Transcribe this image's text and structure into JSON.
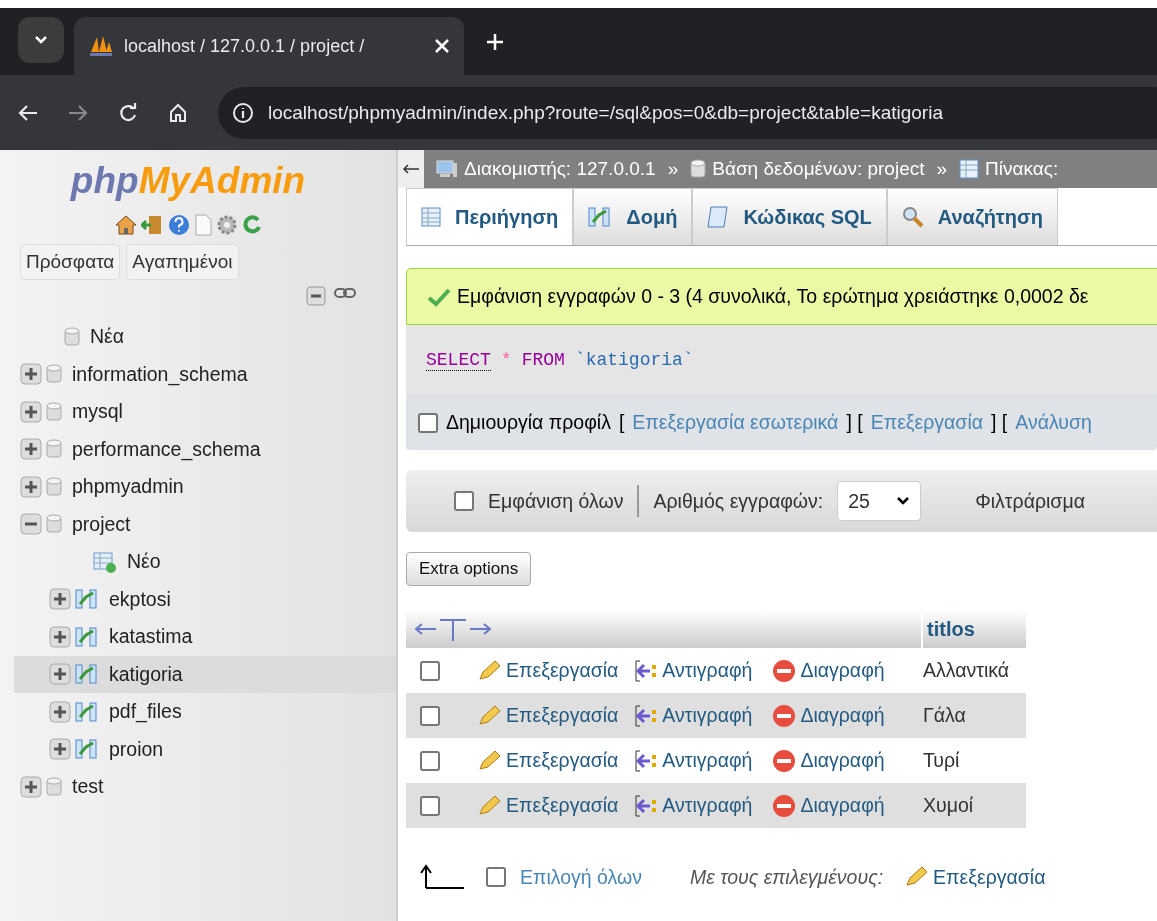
{
  "browser": {
    "tab_title": "localhost / 127.0.0.1 / project /",
    "address": "localhost/phpmyadmin/index.php?route=/sql&pos=0&db=project&table=katigoria"
  },
  "sidebar": {
    "logo_php": "php",
    "logo_rest": "MyAdmin",
    "buttons": [
      "Πρόσφατα",
      "Αγαπημένοι"
    ],
    "tree": [
      {
        "label": "Νέα",
        "kind": "new",
        "selected": false
      },
      {
        "label": "information_schema",
        "kind": "db",
        "expanded": false,
        "selected": false
      },
      {
        "label": "mysql",
        "kind": "db",
        "expanded": false,
        "selected": false
      },
      {
        "label": "performance_schema",
        "kind": "db",
        "expanded": false,
        "selected": false
      },
      {
        "label": "phpmyadmin",
        "kind": "db",
        "expanded": false,
        "selected": false
      },
      {
        "label": "project",
        "kind": "db",
        "expanded": true,
        "selected": false,
        "children": [
          {
            "label": "Νέο",
            "kind": "newtable",
            "selected": false
          },
          {
            "label": "ekptosi",
            "kind": "table",
            "expanded": false,
            "selected": false
          },
          {
            "label": "katastima",
            "kind": "table",
            "expanded": false,
            "selected": false
          },
          {
            "label": "katigoria",
            "kind": "table",
            "expanded": false,
            "selected": true
          },
          {
            "label": "pdf_files",
            "kind": "table",
            "expanded": false,
            "selected": false
          },
          {
            "label": "proion",
            "kind": "table",
            "expanded": false,
            "selected": false
          }
        ]
      },
      {
        "label": "test",
        "kind": "db",
        "expanded": false,
        "selected": false
      }
    ]
  },
  "breadcrumb": [
    {
      "label": "Διακομιστής: 127.0.0.1",
      "kind": "server"
    },
    {
      "separator": "»",
      "label": "Βάση δεδομένων: project",
      "kind": "db"
    },
    {
      "separator": "»",
      "label": "Πίνακας:",
      "kind": "table"
    }
  ],
  "tabs": [
    {
      "label": "Περιήγηση",
      "kind": "browse",
      "selected": true
    },
    {
      "label": "Δομή",
      "kind": "structure",
      "selected": false
    },
    {
      "label": "Κώδικας SQL",
      "kind": "sql",
      "selected": false
    },
    {
      "label": "Αναζήτηση",
      "kind": "search",
      "selected": false
    }
  ],
  "message": "Εμφάνιση εγγραφών 0 - 3 (4 συνολικά, Το ερώτημα χρειάστηκε 0,0002 δε",
  "sql": {
    "keyword": "SELECT",
    "star": "*",
    "from": "FROM",
    "table": "`katigoria`"
  },
  "profile": {
    "label": "Δημιουργία προφίλ",
    "checked": false,
    "parts": [
      {
        "kind": "bracket",
        "text": "["
      },
      {
        "kind": "link",
        "text": "Επεξεργασία εσωτερικά"
      },
      {
        "kind": "bracket",
        "text": "] ["
      },
      {
        "kind": "link",
        "text": "Επεξεργασία"
      },
      {
        "kind": "bracket",
        "text": "] ["
      },
      {
        "kind": "link",
        "text": "Ανάλυση"
      }
    ]
  },
  "navbar": {
    "show_all": "Εμφάνιση όλων",
    "show_all_checked": false,
    "rows_label": "Αριθμός εγγραφών:",
    "rows_value": "25",
    "filter_label": "Φιλτράρισμα"
  },
  "extra_options": "Extra options",
  "table": {
    "column": "titlos",
    "rows": [
      {
        "edit": "Επεξεργασία",
        "copy": "Αντιγραφή",
        "delete": "Διαγραφή",
        "value": "Αλλαντικά",
        "checked": false
      },
      {
        "edit": "Επεξεργασία",
        "copy": "Αντιγραφή",
        "delete": "Διαγραφή",
        "value": "Γάλα",
        "checked": false
      },
      {
        "edit": "Επεξεργασία",
        "copy": "Αντιγραφή",
        "delete": "Διαγραφή",
        "value": "Τυρί",
        "checked": false
      },
      {
        "edit": "Επεξεργασία",
        "copy": "Αντιγραφή",
        "delete": "Διαγραφή",
        "value": "Χυμοί",
        "checked": false
      }
    ]
  },
  "footer": {
    "select_all": "Επιλογή όλων",
    "select_all_checked": false,
    "with_selected": "Με τους επιλεγμένους:",
    "edit": "Επεξεργασία"
  }
}
